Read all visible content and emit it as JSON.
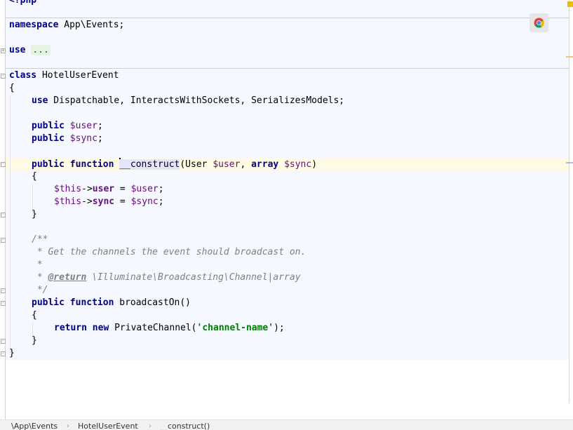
{
  "editor": {
    "lines": {
      "l0": {
        "tok1": "<?php"
      },
      "l1": {
        "tok1": "namespace",
        "tok2": " App\\Events;"
      },
      "l2": {
        "tok1": "use",
        "tok2": " ",
        "tok3": "..."
      },
      "l3": {
        "tok1": "class",
        "tok2": " HotelUserEvent"
      },
      "l4": {
        "tok1": "{"
      },
      "l5": {
        "tok1": "use",
        "tok2": " Dispatchable, InteractsWithSockets, SerializesModels;"
      },
      "l6": {
        "tok1": "public",
        "tok2": " ",
        "tok3": "$user",
        "tok4": ";"
      },
      "l7": {
        "tok1": "public",
        "tok2": " ",
        "tok3": "$sync",
        "tok4": ";"
      },
      "l8": {
        "tok1": "public",
        "tok2": " ",
        "tok3": "function",
        "tok4": " ",
        "tok5": "__construct",
        "tok6": "(User ",
        "tok7": "$user",
        "tok8": ", ",
        "tok9": "array",
        "tok10": " ",
        "tok11": "$sync",
        "tok12": ")"
      },
      "l9": {
        "tok1": "{"
      },
      "l10": {
        "tok1": "$this",
        "tok2": "->",
        "tok3": "user",
        "tok4": " = ",
        "tok5": "$user",
        "tok6": ";"
      },
      "l11": {
        "tok1": "$this",
        "tok2": "->",
        "tok3": "sync",
        "tok4": " = ",
        "tok5": "$sync",
        "tok6": ";"
      },
      "l12": {
        "tok1": "}"
      },
      "l13": {
        "tok1": "/**"
      },
      "l14": {
        "tok1": " * Get the channels the event should broadcast on."
      },
      "l15": {
        "tok1": " *"
      },
      "l16": {
        "tok1": " * ",
        "tok2": "@return",
        "tok3": " \\Illuminate\\Broadcasting\\Channel|array"
      },
      "l17": {
        "tok1": " */"
      },
      "l18": {
        "tok1": "public",
        "tok2": " ",
        "tok3": "function",
        "tok4": " broadcastOn()"
      },
      "l19": {
        "tok1": "{"
      },
      "l20": {
        "tok1": "return",
        "tok2": " ",
        "tok3": "new",
        "tok4": " PrivateChannel(",
        "tok5": "'channel-name'",
        "tok6": ");"
      },
      "l21": {
        "tok1": "}"
      },
      "l22": {
        "tok1": "}"
      }
    },
    "browser_icon": "chrome-icon"
  },
  "breadcrumb": {
    "items": [
      "\\App\\Events",
      "HotelUserEvent",
      "__construct()"
    ],
    "separator": "›"
  },
  "colors": {
    "keyword": "#000080",
    "variable": "#660e7a",
    "string": "#008000",
    "comment": "#808080",
    "warning_marker": "#e8c000"
  }
}
